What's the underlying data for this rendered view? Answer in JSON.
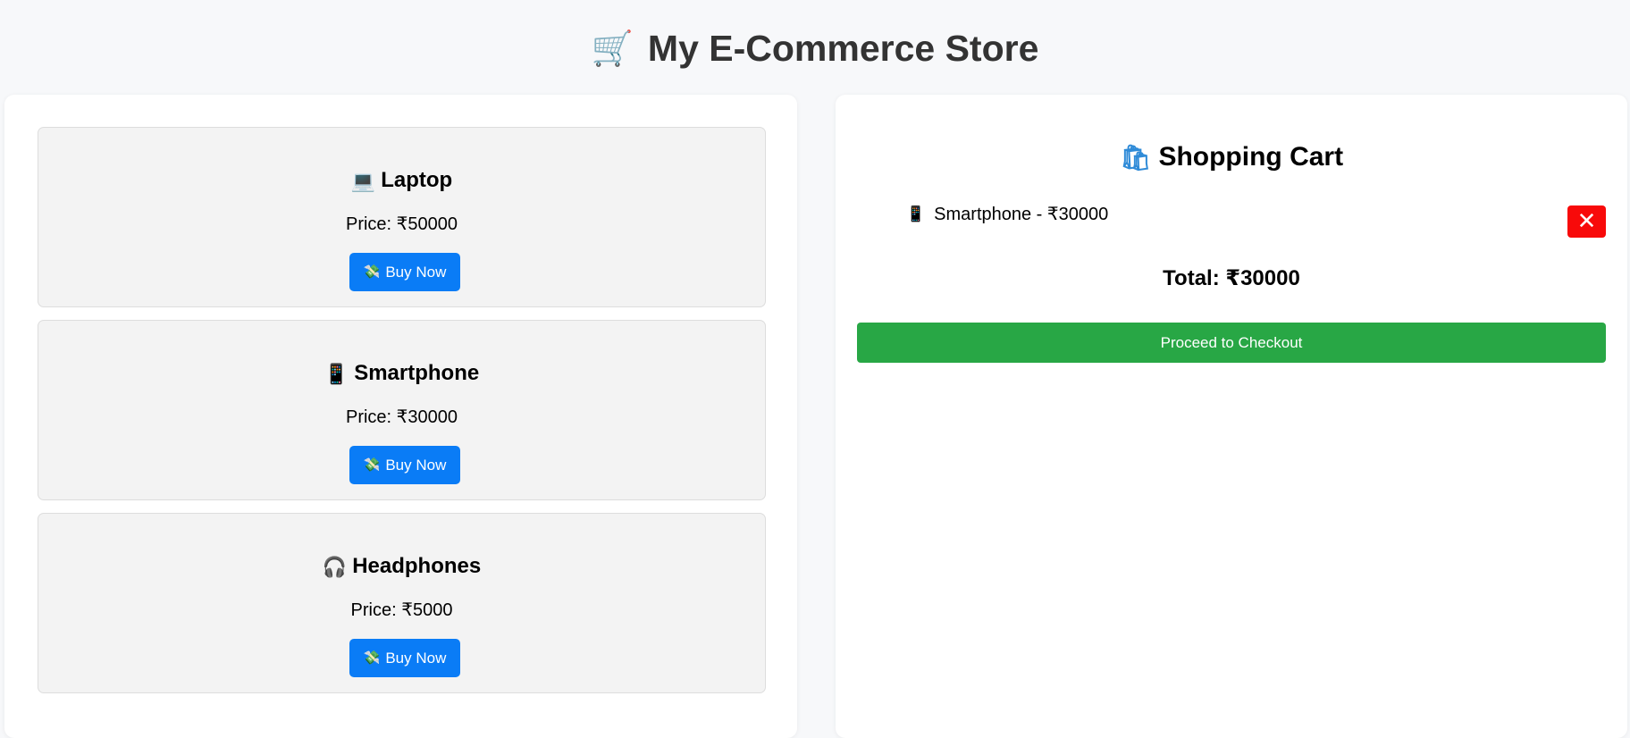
{
  "header": {
    "icon": "shopping-cart-icon",
    "icon_glyph": "🛒",
    "title": "My E-Commerce Store"
  },
  "products": [
    {
      "icon": "laptop-icon",
      "icon_glyph": "💻",
      "name": "Laptop",
      "price": "Price: ₹50000",
      "button_icon": "money-icon",
      "button_icon_glyph": "💸",
      "button_label": "Buy Now"
    },
    {
      "icon": "smartphone-icon",
      "icon_glyph": "📱",
      "name": "Smartphone",
      "price": "Price: ₹30000",
      "button_icon": "money-icon",
      "button_icon_glyph": "💸",
      "button_label": "Buy Now"
    },
    {
      "icon": "headphones-icon",
      "icon_glyph": "🎧",
      "name": "Headphones",
      "price": "Price: ₹5000",
      "button_icon": "money-icon",
      "button_icon_glyph": "💸",
      "button_label": "Buy Now"
    }
  ],
  "cart": {
    "icon": "shopping-bags-icon",
    "icon_glyph": "🛍",
    "title": "Shopping Cart",
    "items": [
      {
        "icon": "smartphone-icon",
        "icon_glyph": "📱",
        "text": "Smartphone - ₹30000",
        "remove_icon": "close-icon",
        "remove_glyph": "✕"
      }
    ],
    "total": "Total: ₹30000",
    "checkout_label": "Proceed to Checkout"
  },
  "colors": {
    "page_background": "#f7f8fa",
    "buy_button": "#0a7cf6",
    "remove_button": "#f80a0a",
    "checkout_button": "#28a745",
    "card_background": "#f3f3f3"
  }
}
